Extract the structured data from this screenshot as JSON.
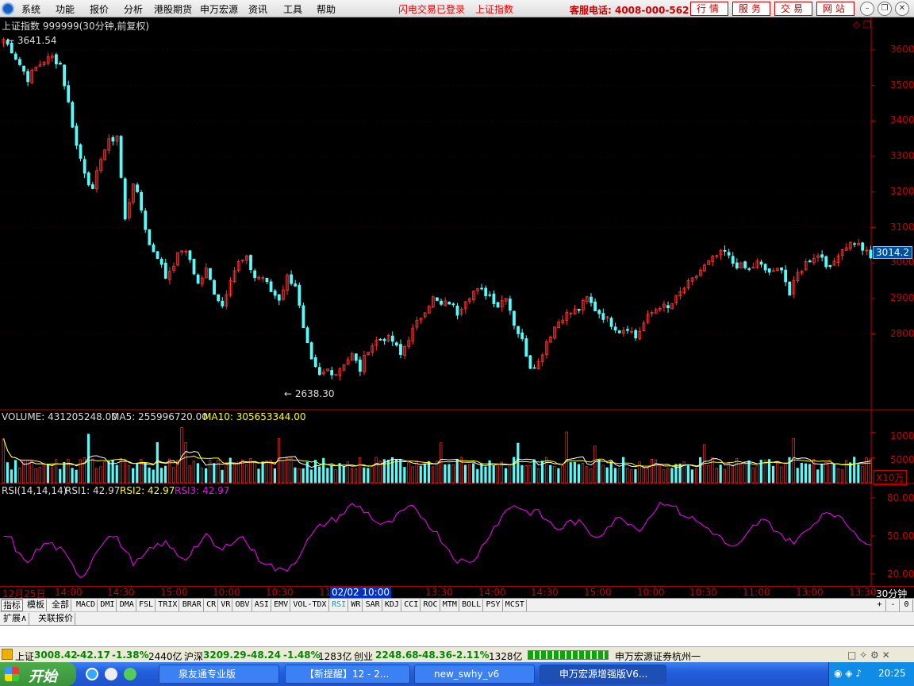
{
  "menu": {
    "items": [
      "系统",
      "功能",
      "报价",
      "分析",
      "港股期货",
      "申万宏源",
      "资讯",
      "工具",
      "帮助"
    ],
    "notice_login": "闪电交易已登录",
    "notice_index": "上证指数",
    "hotline": "客服电话: 4008-000-562",
    "buttons": [
      "行情",
      "服务",
      "交易",
      "网站"
    ]
  },
  "chart": {
    "title": "上证指数 999999(30分钟,前复权)",
    "high_label": "3641.54",
    "low_label": "2638.30",
    "current_price": "3014.2",
    "price_ticks": [
      "3600",
      "3500",
      "3400",
      "3300",
      "3200",
      "3100",
      "3000",
      "2900",
      "2800"
    ],
    "volume_header": {
      "volume": "VOLUME: 431205248.00",
      "ma5": "MA5: 255996720.00",
      "ma10": "MA10: 305653344.00"
    },
    "volume_ticks": [
      "10000",
      "5000"
    ],
    "volume_unit": "X10万",
    "rsi_header": {
      "label": "RSI(14,14,14)",
      "rsi1": "RSI1: 42.97",
      "rsi2": "RSI2: 42.97",
      "rsi3": "RSI3: 42.97"
    },
    "rsi_ticks": [
      "80.00",
      "50.00",
      "20.00"
    ],
    "colors": {
      "up": "#ff3232",
      "down": "#54fcfc",
      "ma5": "#ffffff",
      "ma10": "#ffff00",
      "rsi": "#ff00ff",
      "axis": "#c00000"
    }
  },
  "chart_data": {
    "type": "candlestick",
    "title": "上证指数 999999(30分钟,前复权)",
    "y_ticks": [
      2800,
      2900,
      3000,
      3100,
      3200,
      3300,
      3400,
      3500,
      3600
    ],
    "high": 3641.54,
    "low": 2638.3,
    "last": 3014.2,
    "close_path": [
      3630,
      3600,
      3560,
      3520,
      3550,
      3570,
      3580,
      3560,
      3450,
      3330,
      3260,
      3200,
      3300,
      3340,
      3360,
      3120,
      3230,
      3150,
      3050,
      3020,
      2960,
      3000,
      3040,
      3010,
      2940,
      2980,
      2920,
      2880,
      2960,
      3000,
      3010,
      2960,
      2960,
      2920,
      2900,
      2960,
      2940,
      2810,
      2720,
      2680,
      2700,
      2690,
      2720,
      2740,
      2700,
      2760,
      2780,
      2790,
      2780,
      2740,
      2790,
      2830,
      2870,
      2900,
      2880,
      2890,
      2860,
      2900,
      2920,
      2920,
      2910,
      2880,
      2910,
      2830,
      2780,
      2710,
      2720,
      2780,
      2820,
      2850,
      2860,
      2870,
      2900,
      2870,
      2850,
      2830,
      2810,
      2820,
      2790,
      2830,
      2860,
      2880,
      2870,
      2900,
      2930,
      2950,
      2980,
      3000,
      3020,
      3030,
      3000,
      2990,
      2980,
      3000,
      2980,
      2970,
      2990,
      2910,
      2970,
      3000,
      3020,
      3020,
      2980,
      3030,
      3050,
      3060,
      3040,
      3014.2
    ],
    "volume": {
      "ticks": [
        5000,
        10000
      ],
      "unit": "X10万",
      "volume": 431205248.0,
      "ma5": 255996720.0,
      "ma10": 305653344.0
    },
    "rsi": {
      "params": [
        14,
        14,
        14
      ],
      "ticks": [
        20,
        50,
        80
      ],
      "rsi1": 42.97,
      "rsi2": 42.97,
      "rsi3": 42.97,
      "values": [
        50,
        48,
        36,
        28,
        35,
        40,
        45,
        42,
        38,
        30,
        22,
        18,
        30,
        42,
        48,
        50,
        45,
        35,
        28,
        32,
        38,
        42,
        45,
        40,
        35,
        32,
        40,
        45,
        50,
        42,
        38,
        44,
        50,
        48,
        40,
        32,
        30,
        25,
        22,
        25,
        30,
        40,
        48,
        55,
        60,
        62,
        65,
        70,
        75,
        72,
        68,
        62,
        58,
        60,
        65,
        70,
        72,
        68,
        62,
        55,
        48,
        40,
        32,
        30,
        28,
        35,
        45,
        55,
        62,
        70,
        75,
        72,
        68,
        70,
        65,
        60,
        55,
        58,
        62,
        60,
        55,
        50,
        52,
        58,
        62,
        65,
        60,
        55,
        60,
        68,
        75,
        78,
        72,
        68,
        65,
        62,
        58,
        55,
        50,
        45,
        40,
        42,
        50,
        58,
        62,
        60,
        55,
        50,
        45,
        48,
        52,
        58,
        66,
        70,
        68,
        62,
        58,
        52,
        47,
        43
      ]
    }
  },
  "time_axis": {
    "labels": [
      "12月25日",
      "14:00",
      "14:30",
      "15:00",
      "10:00",
      "10:30",
      "11",
      "02/02 10:00",
      "13:30",
      "14:00",
      "14:30",
      "15:00",
      "10:00",
      "10:30",
      "11:00",
      "13:00",
      "13:30"
    ],
    "right_label": "30分钟"
  },
  "indicators": {
    "tabs": [
      "指标",
      "模板",
      "全部",
      "MACD",
      "DMI",
      "DMA",
      "FSL",
      "TRIX",
      "BRAR",
      "CR",
      "VR",
      "OBV",
      "ASI",
      "EMV",
      "VOL-TDX",
      "RSI",
      "WR",
      "SAR",
      "KDJ",
      "CCI",
      "ROC",
      "MTM",
      "BOLL",
      "PSY",
      "MCST"
    ],
    "active": "RSI",
    "controls": [
      "+",
      "-",
      "0"
    ]
  },
  "extension_tabs": [
    "扩展∧",
    "关联报价"
  ],
  "status": {
    "sh_label": "上证",
    "sh_value": "3008.42",
    "sh_change": "-42.17",
    "sh_pct": "-1.38%",
    "sh_amount": "2440亿",
    "hs_label": "沪深",
    "hs_value": "3209.29",
    "hs_change": "-48.24",
    "hs_pct": "-1.48%",
    "hs_amount": "1283亿",
    "cy_label": "创业",
    "cy_value": "2248.68",
    "cy_change": "-48.36",
    "cy_pct": "-2.11%",
    "cy_amount": "1328亿",
    "broker": "申万宏源证券杭州一"
  },
  "taskbar": {
    "start": "开始",
    "tasks": [
      "泉友通专业版",
      "【新提醒】12 - 2...",
      "new_swhy_v6",
      "申万宏源增强版V6..."
    ],
    "clock": "20:25"
  }
}
